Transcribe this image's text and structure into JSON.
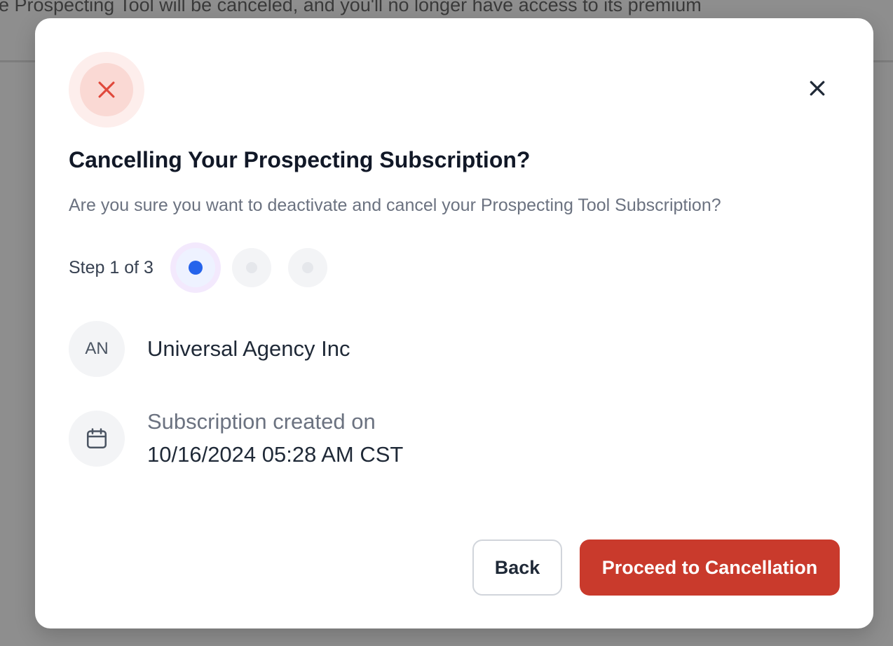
{
  "background": {
    "banner_text": "e Prospecting Tool will be canceled, and you'll no longer have access to its premium"
  },
  "modal": {
    "title": "Cancelling Your Prospecting Subscription?",
    "subtitle": "Are you sure you want to deactivate and cancel your Prospecting Tool Subscription?",
    "close_icon": "close-icon",
    "hero_icon": "x-icon",
    "stepper": {
      "label": "Step 1 of 3",
      "current": 1,
      "total": 3
    },
    "agency": {
      "initials": "AN",
      "name": "Universal Agency Inc"
    },
    "subscription": {
      "icon": "calendar-icon",
      "label": "Subscription created on",
      "date": "10/16/2024 05:28 AM CST"
    },
    "buttons": {
      "back": "Back",
      "proceed": "Proceed to Cancellation"
    }
  },
  "colors": {
    "danger": "#c93a2c",
    "step_active": "#2563eb",
    "hero_icon": "#e0483b"
  }
}
